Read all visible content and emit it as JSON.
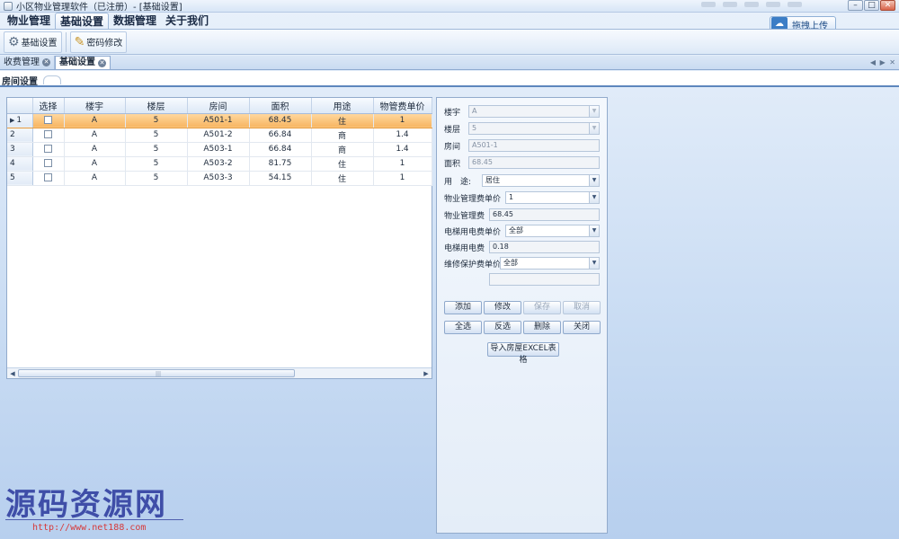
{
  "window": {
    "title": "小区物业管理软件（已注册）- [基础设置]",
    "min": "–",
    "max": "□",
    "close": "✕"
  },
  "menu": {
    "items": [
      "物业管理",
      "基础设置",
      "数据管理",
      "关于我们"
    ]
  },
  "upload": {
    "label": "拖拽上传",
    "icon": "cloud-icon"
  },
  "ribbon": {
    "base_settings": "基础设置",
    "change_password": "密码修改"
  },
  "doc_tabs": {
    "tab1": "收费管理",
    "tab2": "基础设置",
    "nav": "◀ ▶ ✕"
  },
  "sub_tab": {
    "label": "房间设置"
  },
  "grid": {
    "headers": [
      "",
      "选择",
      "楼宇",
      "楼层",
      "房间",
      "面积",
      "用途",
      "物管费单价"
    ],
    "rows": [
      {
        "num": "1",
        "building": "A",
        "floor": "5",
        "room": "A501-1",
        "area": "68.45",
        "use": "住",
        "price": "1"
      },
      {
        "num": "2",
        "building": "A",
        "floor": "5",
        "room": "A501-2",
        "area": "66.84",
        "use": "商",
        "price": "1.4"
      },
      {
        "num": "3",
        "building": "A",
        "floor": "5",
        "room": "A503-1",
        "area": "66.84",
        "use": "商",
        "price": "1.4"
      },
      {
        "num": "4",
        "building": "A",
        "floor": "5",
        "room": "A503-2",
        "area": "81.75",
        "use": "住",
        "price": "1"
      },
      {
        "num": "5",
        "building": "A",
        "floor": "5",
        "room": "A503-3",
        "area": "54.15",
        "use": "住",
        "price": "1"
      }
    ],
    "scroll_grip": "|||"
  },
  "form": {
    "building_label": "楼宇",
    "building_value": "A",
    "floor_label": "楼层",
    "floor_value": "5",
    "room_label": "房间",
    "room_value": "A501-1",
    "area_label": "面积",
    "area_value": "68.45",
    "use_label": "用　途:",
    "use_value": "居住",
    "fee_price_label": "物业管理费单价",
    "fee_price_value": "1",
    "fee_label": "物业管理费",
    "fee_value": "68.45",
    "elevator_price_label": "电梯用电费单价",
    "elevator_price_value": "全部",
    "elevator_fee_label": "电梯用电费",
    "elevator_fee_value": "0.18",
    "maint_price_label": "维修保护费单价",
    "maint_price_value": "全部",
    "buttons": {
      "add": "添加",
      "edit": "修改",
      "save": "保存",
      "cancel": "取消",
      "select_all": "全选",
      "invert": "反选",
      "delete": "删除",
      "close": "关闭",
      "import_excel": "导入房屋EXCEL表格"
    }
  },
  "watermark": {
    "logo": "源码资源网",
    "url": "http://www.net188.com"
  }
}
